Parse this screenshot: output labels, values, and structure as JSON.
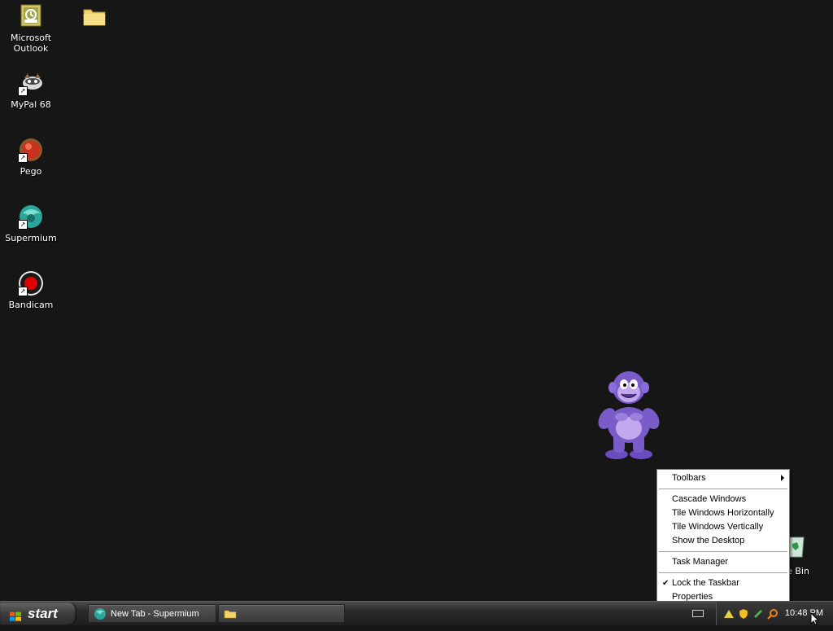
{
  "desktop": {
    "icons": [
      {
        "label": "Microsoft Outlook",
        "icon": "outlook-icon"
      },
      {
        "label": "",
        "icon": "folder-icon"
      },
      {
        "label": "MyPal 68",
        "icon": "mypal-icon"
      },
      {
        "label": "Pego",
        "icon": "pego-icon"
      },
      {
        "label": "Supermium",
        "icon": "supermium-icon"
      },
      {
        "label": "Bandicam",
        "icon": "bandicam-icon"
      }
    ],
    "recycle_bin_label": "cle Bin"
  },
  "context_menu": {
    "items": [
      {
        "label": "Toolbars",
        "submenu": true
      },
      {
        "label": "Cascade Windows"
      },
      {
        "label": "Tile Windows Horizontally"
      },
      {
        "label": "Tile Windows Vertically"
      },
      {
        "label": "Show the Desktop"
      },
      {
        "label": "Task Manager"
      },
      {
        "label": "Lock the Taskbar",
        "checked": true
      },
      {
        "label": "Properties"
      }
    ]
  },
  "taskbar": {
    "start_label": "start",
    "tasks": [
      {
        "label": "New Tab - Supermium",
        "icon": "supermium-icon"
      },
      {
        "label": "",
        "icon": "folder-icon"
      }
    ],
    "clock": "10:48 PM"
  },
  "colors": {
    "desktop_bg": "#161616",
    "menu_bg": "#ffffff",
    "bonzi_purple": "#7a5cc8"
  }
}
